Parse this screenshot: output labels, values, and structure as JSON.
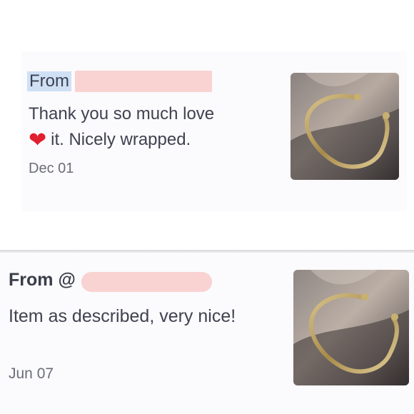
{
  "reviews": [
    {
      "from_label": "From",
      "message_line1": "Thank you so much love",
      "message_line2": "it. Nicely wrapped.",
      "emoji": "❤",
      "date": "Dec 01",
      "thumbnail_icon": "gold-bangle-photo"
    },
    {
      "from_label": "From @",
      "message": "Item as described, very nice!",
      "date": "Jun 07",
      "thumbnail_icon": "gold-bangle-photo"
    }
  ],
  "colors": {
    "highlight": "#cfe0f5",
    "redaction": "#f9d2d2",
    "card_bg": "#fbfafc",
    "text": "#3f4250",
    "muted": "#6b6e78",
    "heart": "#e0202e"
  }
}
